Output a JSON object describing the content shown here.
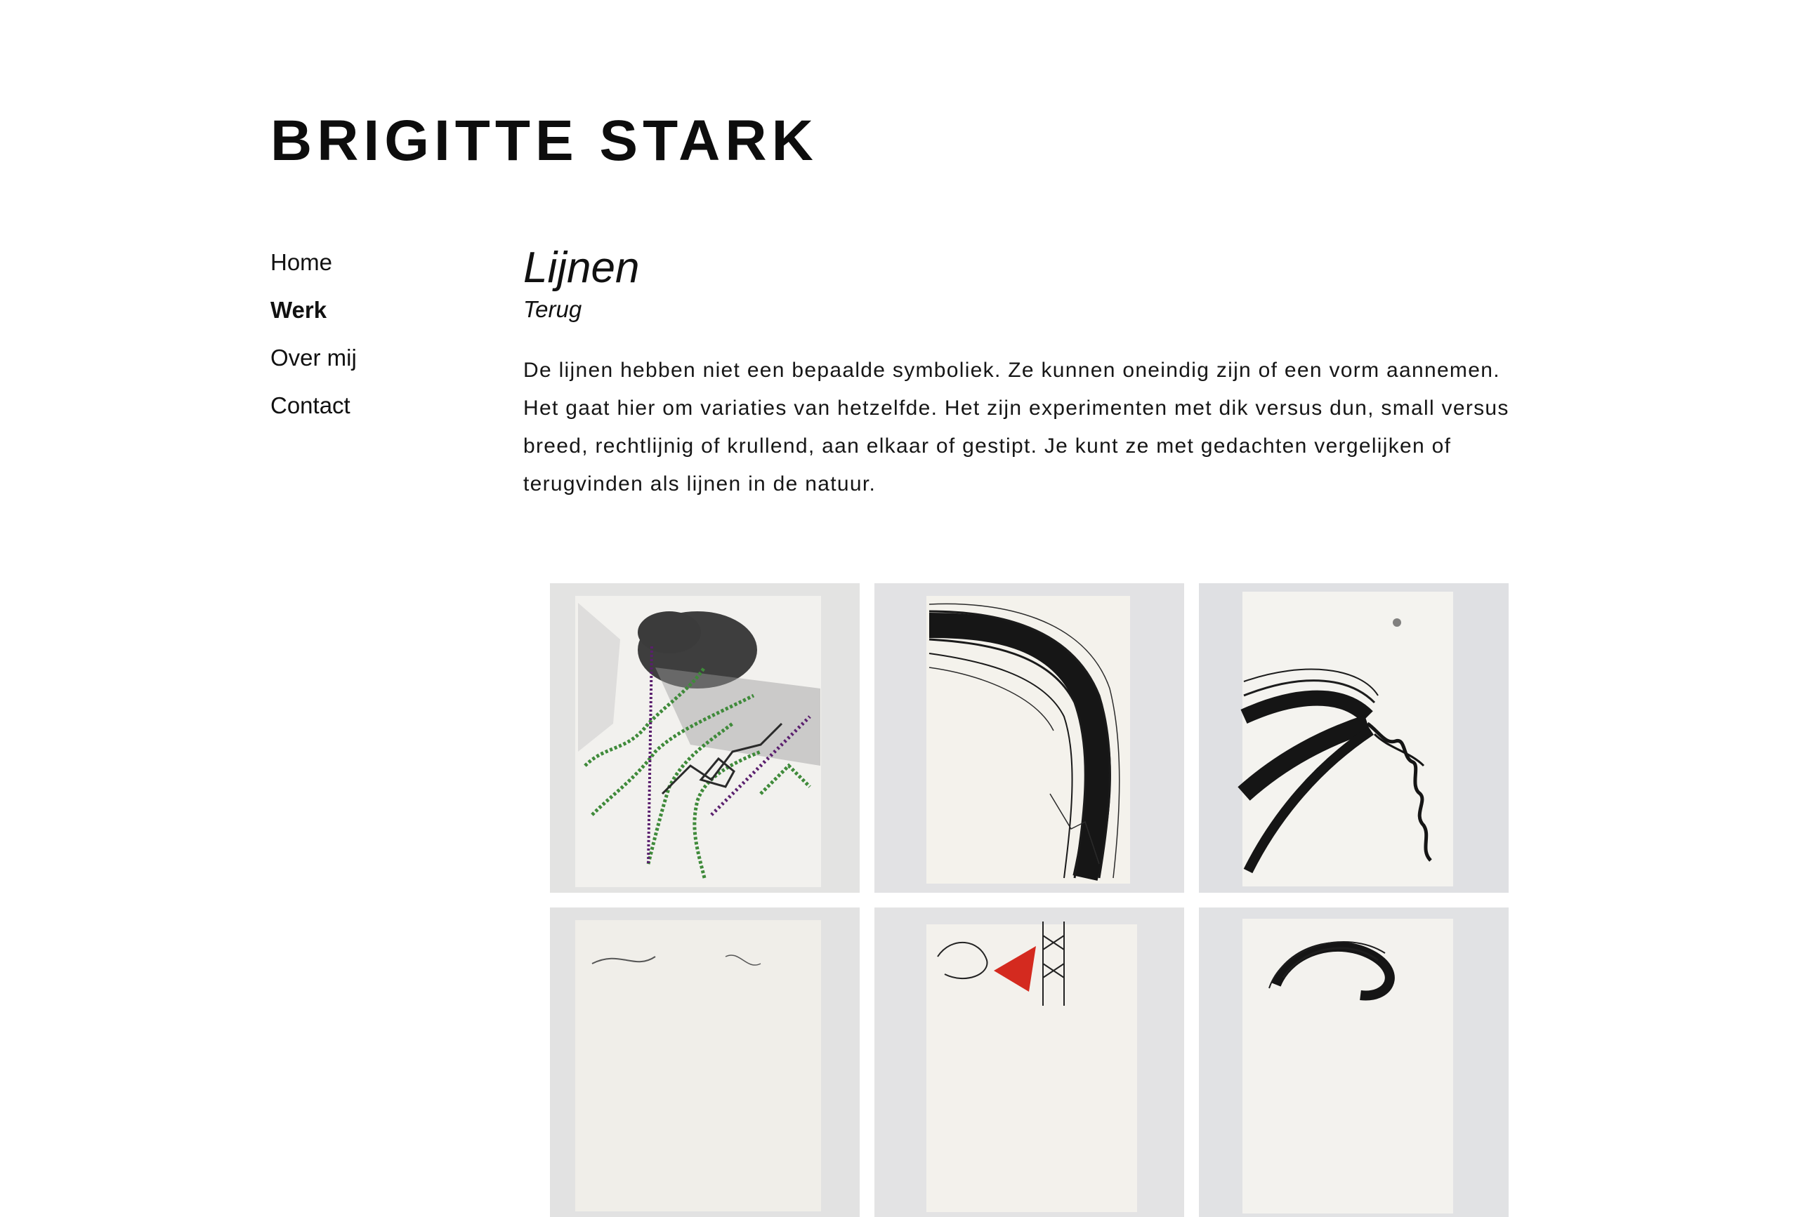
{
  "site": {
    "title": "BRIGITTE STARK"
  },
  "nav": {
    "items": [
      {
        "label": "Home",
        "active": false
      },
      {
        "label": "Werk",
        "active": true
      },
      {
        "label": "Over mij",
        "active": false
      },
      {
        "label": "Contact",
        "active": false
      }
    ]
  },
  "main": {
    "title": "Lijnen",
    "back_label": "Terug",
    "description": "De lijnen hebben niet een bepaalde symboliek. Ze kunnen oneindig zijn of een vorm aannemen. Het gaat hier om variaties van hetzelfde. Het zijn experimenten met dik versus dun, small versus breed, rechtlijnig of krullend, aan elkaar of gestipt. Je kunt ze met gedachten vergelijken of terugvinden als lijnen in de natuur."
  },
  "gallery": {
    "tiles": [
      {
        "name": "artwork-embroidered-lines",
        "colors": [
          "#3f8a3a",
          "#5a1f6e",
          "#1a1a1a"
        ]
      },
      {
        "name": "artwork-ink-arc",
        "colors": [
          "#111111"
        ]
      },
      {
        "name": "artwork-ink-wave",
        "colors": [
          "#111111"
        ]
      },
      {
        "name": "artwork-faint-lines",
        "colors": [
          "#555555"
        ]
      },
      {
        "name": "artwork-red-tower",
        "colors": [
          "#d42a1f",
          "#222222"
        ]
      },
      {
        "name": "artwork-ink-spiral",
        "colors": [
          "#111111"
        ]
      }
    ]
  }
}
